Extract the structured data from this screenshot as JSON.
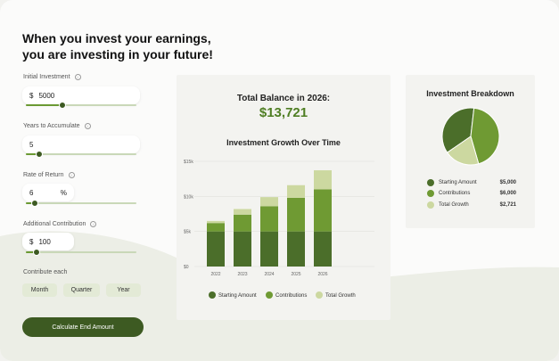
{
  "headline": {
    "line1": "When you invest your earnings,",
    "line2": "you are investing in your future!"
  },
  "fields": {
    "initial": {
      "label": "Initial Investment",
      "prefix": "$",
      "value": "5000",
      "slider_fraction": 0.33
    },
    "years": {
      "label": "Years to Accumulate",
      "value": "5",
      "slider_fraction": 0.12
    },
    "rate": {
      "label": "Rate of Return",
      "value": "6",
      "suffix": "%",
      "slider_fraction": 0.08
    },
    "additional": {
      "label": "Additional Contribution",
      "prefix": "$",
      "value": "100",
      "slider_fraction": 0.1
    }
  },
  "contribute": {
    "label": "Contribute each",
    "options": [
      "Month",
      "Quarter",
      "Year"
    ]
  },
  "calculate_label": "Calculate End Amount",
  "result": {
    "label": "Total Balance in 2026:",
    "value": "$13,721"
  },
  "chart_title": "Investment Growth Over Time",
  "breakdown": {
    "title": "Investment Breakdown",
    "items": [
      {
        "label": "Starting Amount",
        "value": "$5,000"
      },
      {
        "label": "Contributions",
        "value": "$6,000"
      },
      {
        "label": "Total Growth",
        "value": "$2,721"
      }
    ]
  },
  "colors": {
    "starting": "#4b6e2a",
    "contributions": "#6f9a33",
    "growth": "#ccd8a0",
    "accent": "#4f7e23",
    "button": "#3d5a22"
  },
  "chart_data": {
    "type": "bar",
    "stacked": true,
    "categories": [
      "2022",
      "2023",
      "2024",
      "2025",
      "2026"
    ],
    "series": [
      {
        "name": "Starting Amount",
        "values": [
          5000,
          5000,
          5000,
          5000,
          5000
        ]
      },
      {
        "name": "Contributions",
        "values": [
          1200,
          2400,
          3600,
          4800,
          6000
        ]
      },
      {
        "name": "Total Growth",
        "values": [
          300,
          800,
          1300,
          1800,
          2721
        ]
      }
    ],
    "yticks": [
      "$0",
      "$5k",
      "$10k",
      "$15k"
    ],
    "ylim": [
      0,
      15000
    ],
    "grid": true,
    "legend": "bottom"
  }
}
